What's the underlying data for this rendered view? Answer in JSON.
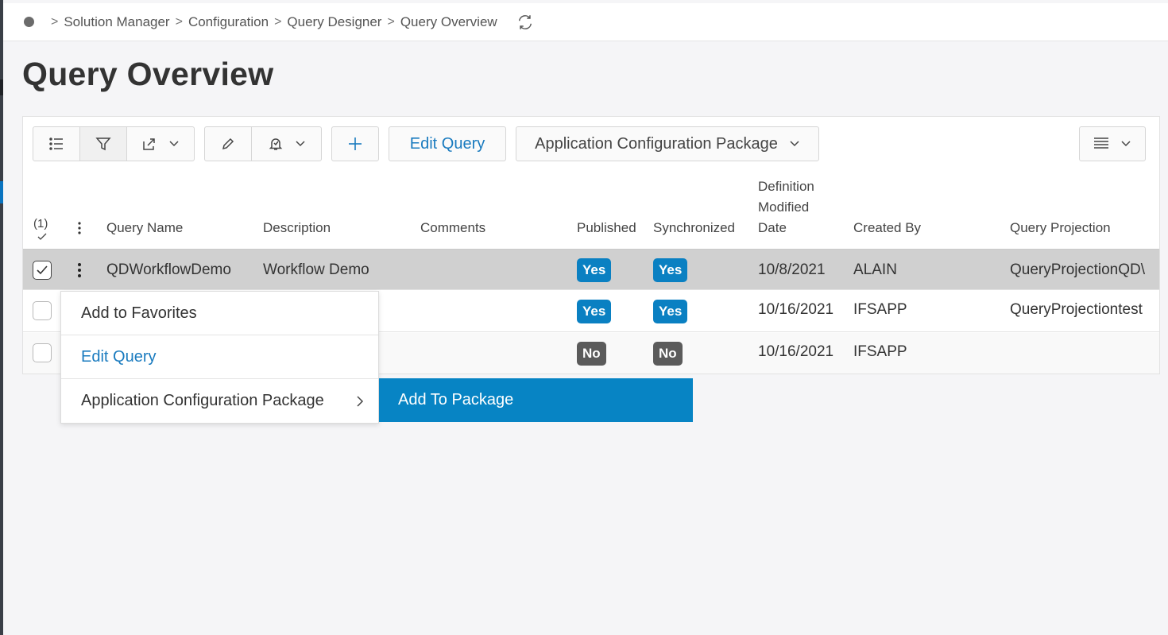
{
  "breadcrumb": {
    "items": [
      "Solution Manager",
      "Configuration",
      "Query Designer",
      "Query Overview"
    ],
    "separator": ">"
  },
  "page": {
    "title": "Query Overview"
  },
  "toolbar": {
    "edit_query_label": "Edit Query",
    "app_config_package_label": "Application Configuration Package"
  },
  "table": {
    "selection_count": "(1)",
    "headers": {
      "query_name": "Query Name",
      "description": "Description",
      "comments": "Comments",
      "published": "Published",
      "synchronized": "Synchronized",
      "definition_modified_date_1": "Definition",
      "definition_modified_date_2": "Modified",
      "definition_modified_date_3": "Date",
      "created_by": "Created By",
      "query_projection": "Query Projection"
    },
    "rows": [
      {
        "query_name": "QDWorkflowDemo",
        "description": "Workflow Demo",
        "comments": "",
        "published": "Yes",
        "synchronized": "Yes",
        "date": "10/8/2021",
        "created_by": "ALAIN",
        "projection": "QueryProjectionQD\\"
      },
      {
        "query_name": "",
        "description": "",
        "comments": "",
        "published": "Yes",
        "synchronized": "Yes",
        "date": "10/16/2021",
        "created_by": "IFSAPP",
        "projection": "QueryProjectiontest"
      },
      {
        "query_name": "",
        "description": "",
        "comments": "",
        "published": "No",
        "synchronized": "No",
        "date": "10/16/2021",
        "created_by": "IFSAPP",
        "projection": ""
      }
    ]
  },
  "context_menu": {
    "items": [
      "Add to Favorites",
      "Edit Query",
      "Application Configuration Package"
    ],
    "submenu": [
      "Add To Package"
    ]
  },
  "colors": {
    "accent": "#0a80c2",
    "link": "#1a7bbf",
    "badge_no": "#5b5b5b",
    "selected_row": "#d0d0d0"
  }
}
